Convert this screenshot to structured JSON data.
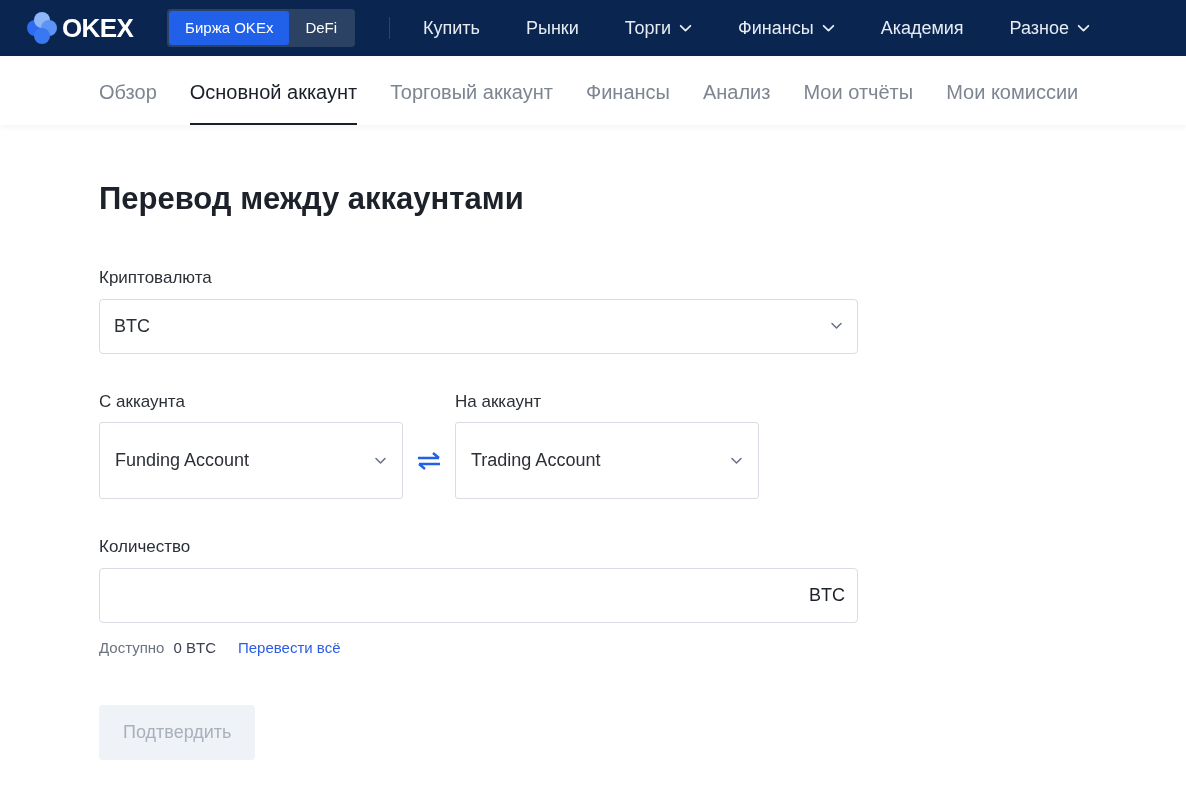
{
  "header": {
    "logo": "OKEX",
    "switch": [
      {
        "label": "Биржа OKEx",
        "selected": true
      },
      {
        "label": "DeFi",
        "selected": false
      }
    ],
    "nav": [
      {
        "label": "Купить",
        "dropdown": false
      },
      {
        "label": "Рынки",
        "dropdown": false
      },
      {
        "label": "Торги",
        "dropdown": true
      },
      {
        "label": "Финансы",
        "dropdown": true
      },
      {
        "label": "Академия",
        "dropdown": false
      },
      {
        "label": "Разное",
        "dropdown": true
      }
    ]
  },
  "tabs": [
    {
      "label": "Обзор",
      "selected": false
    },
    {
      "label": "Основной аккаунт",
      "selected": true
    },
    {
      "label": "Торговый аккаунт",
      "selected": false
    },
    {
      "label": "Финансы",
      "selected": false
    },
    {
      "label": "Анализ",
      "selected": false
    },
    {
      "label": "Мои отчёты",
      "selected": false
    },
    {
      "label": "Мои комиссии",
      "selected": false
    }
  ],
  "form": {
    "title": "Перевод между аккаунтами",
    "currency": {
      "label": "Криптовалюта",
      "value": "BTC"
    },
    "from": {
      "label": "С аккаунта",
      "value": "Funding Account"
    },
    "to": {
      "label": "На аккаунт",
      "value": "Trading Account"
    },
    "amount": {
      "label": "Количество",
      "unit": "BTC"
    },
    "available": {
      "label": "Доступно",
      "value": "0 BTC",
      "link": "Перевести всё"
    },
    "submit": {
      "label": "Подтвердить",
      "disabled": true
    }
  }
}
